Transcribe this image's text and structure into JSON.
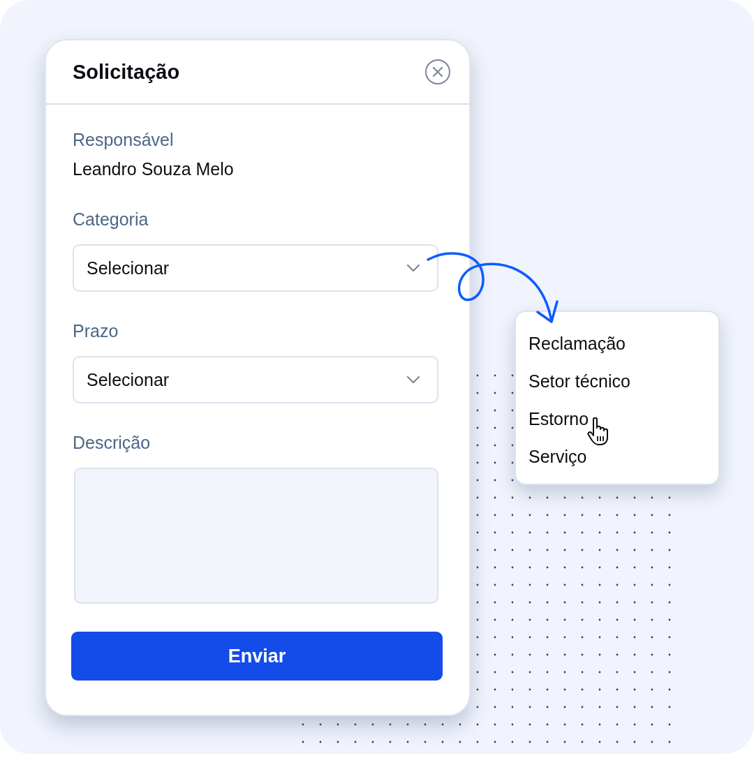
{
  "dialog": {
    "title": "Solicitação",
    "fields": [
      {
        "kind": "text",
        "label": "Responsável",
        "value": "Leandro Souza Melo"
      },
      {
        "kind": "select",
        "label": "Categoria",
        "value": "Selecionar"
      },
      {
        "kind": "select",
        "label": "Prazo",
        "value": "Selecionar"
      },
      {
        "kind": "textarea",
        "label": "Descrição"
      }
    ],
    "submit": "Enviar"
  },
  "menu": {
    "options": [
      {
        "label": "Reclamação",
        "hovered": false
      },
      {
        "label": "Setor técnico",
        "hovered": false
      },
      {
        "label": "Estorno",
        "hovered": true
      },
      {
        "label": "Serviço",
        "hovered": false
      }
    ]
  }
}
